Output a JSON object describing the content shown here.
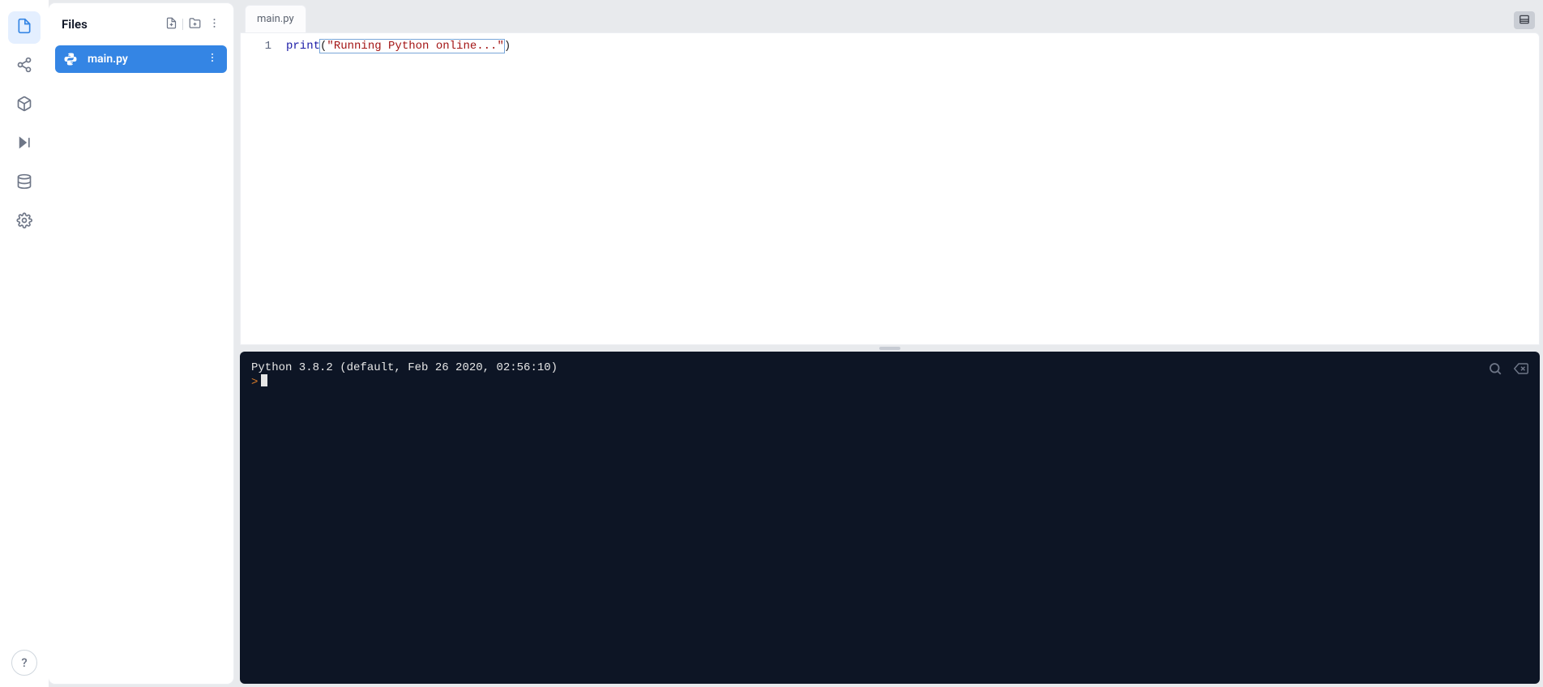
{
  "rail": {
    "items": [
      {
        "name": "files",
        "active": true
      },
      {
        "name": "version-control",
        "active": false
      },
      {
        "name": "packages",
        "active": false
      },
      {
        "name": "run",
        "active": false
      },
      {
        "name": "database",
        "active": false
      },
      {
        "name": "settings",
        "active": false
      }
    ],
    "help_label": "?"
  },
  "files_panel": {
    "title": "Files",
    "items": [
      {
        "name": "main.py",
        "selected": true
      }
    ]
  },
  "tabs": [
    {
      "label": "main.py",
      "active": true
    }
  ],
  "editor": {
    "lines": [
      {
        "num": "1",
        "tokens": {
          "fn": "print",
          "open": "(",
          "str": "\"Running Python online...\"",
          "close": ")"
        }
      }
    ]
  },
  "console": {
    "banner": "Python 3.8.2 (default, Feb 26 2020, 02:56:10)",
    "prompt": ">"
  }
}
